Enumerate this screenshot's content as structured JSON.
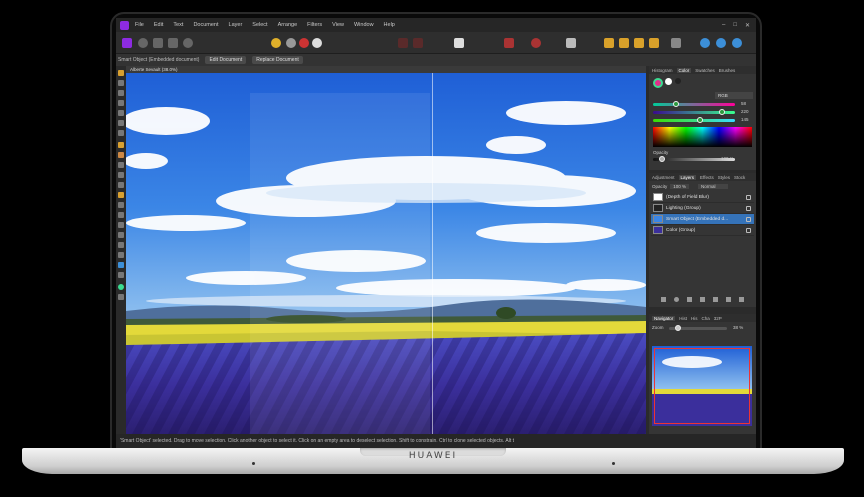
{
  "menu": [
    "File",
    "Edit",
    "Text",
    "Document",
    "Layer",
    "Select",
    "Arrange",
    "Filters",
    "View",
    "Window",
    "Help"
  ],
  "context_bar": {
    "label": "Smart Object (Embedded document)",
    "edit_button": "Edit Document",
    "replace_button": "Replace Document"
  },
  "document_tab": "Alberte Sevault (38.0%)",
  "panels": {
    "top_tabs": [
      "Histogram",
      "Color",
      "Swatches",
      "Brushes"
    ],
    "top_active": "Color",
    "color_mode": "RGB",
    "rgb_values": [
      "58",
      "220",
      "145"
    ],
    "opacity_label": "Opacity",
    "opacity_value": "100 %",
    "layer_tabs": [
      "Adjustment",
      "Layers",
      "Effects",
      "Styles",
      "Stock"
    ],
    "layer_active": "Layers",
    "layer_opacity_label": "Opacity",
    "layer_opacity_value": "100 %",
    "blend_mode": "Normal",
    "layers": [
      {
        "name": "(Depth of Field Blur)",
        "selected": false
      },
      {
        "name": "Lighting (Group)",
        "selected": false
      },
      {
        "name": "Smart Object (Embedded d...",
        "selected": true
      },
      {
        "name": "Color (Group)",
        "selected": false
      }
    ],
    "nav_tabs": [
      "Navigator",
      "Hist",
      "His",
      "Cha",
      "32P"
    ],
    "nav_active": "Navigator",
    "zoom_label": "Zoom",
    "zoom_value": "38 %"
  },
  "status_bar": "'Smart Object' selected. Drag to move selection. Click another object to select it. Click on an empty area to deselect selection. Shift to constrain. Ctrl to clone selected objects. Alt t",
  "device_brand": "HUAWEI",
  "colors": {
    "accent": "#8d2be2",
    "selection": "#3573b9",
    "primary_swatch": "#3adc91"
  }
}
